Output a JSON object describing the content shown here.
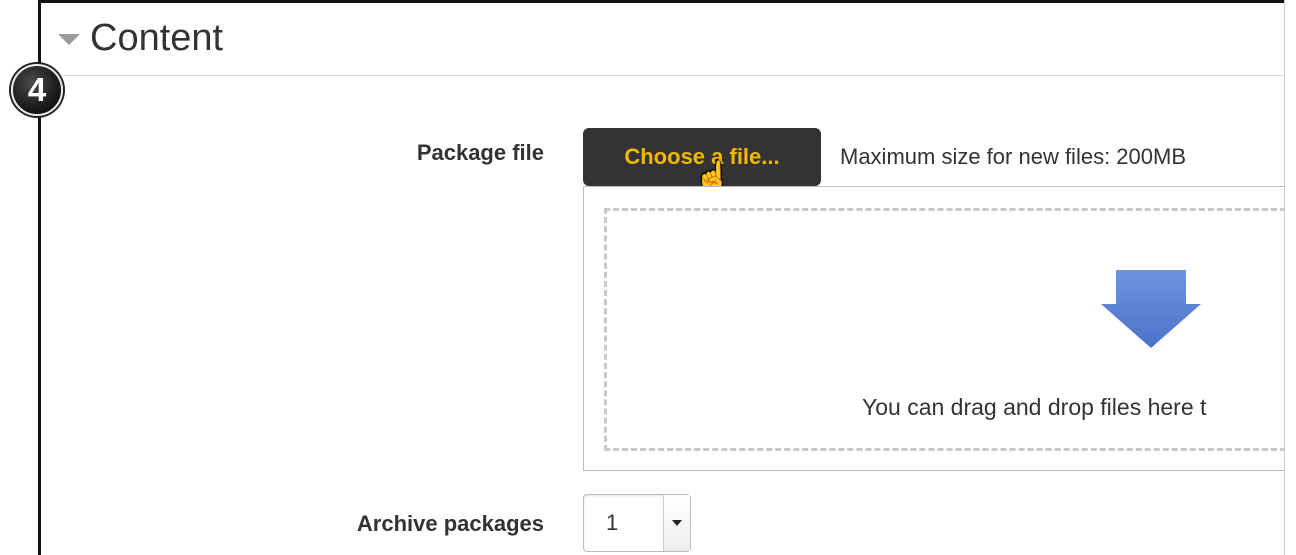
{
  "badge": {
    "number": "4"
  },
  "section": {
    "title": "Content",
    "collapse_icon": "collapse-triangle-icon"
  },
  "package_file": {
    "label": "Package file",
    "choose_button": "Choose a file...",
    "max_size": "Maximum size for new files: 200MB",
    "drop_text": "You can drag and drop files here t",
    "arrow_icon": "download-arrow-icon"
  },
  "archive": {
    "label": "Archive packages",
    "value": "1"
  },
  "colors": {
    "button_bg": "#333333",
    "button_text": "#f5b800",
    "arrow": "#5b83d4"
  }
}
